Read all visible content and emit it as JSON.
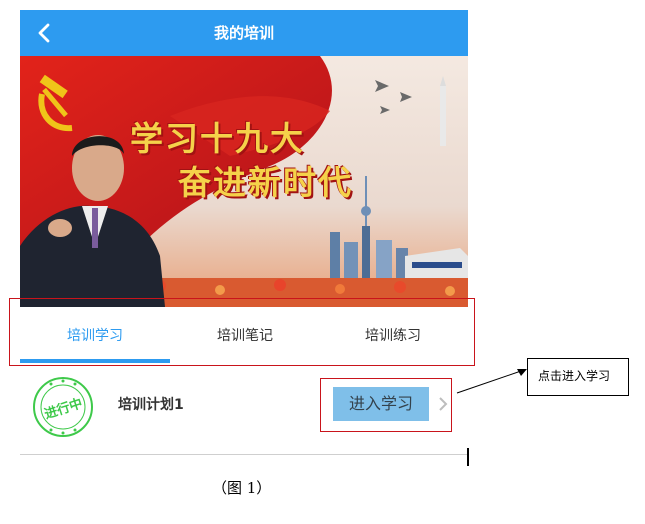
{
  "header": {
    "title": "我的培训",
    "back_icon": "chevron-left-icon"
  },
  "banner": {
    "line1": "学习十九大",
    "line2": "奋进新时代"
  },
  "tabs": [
    {
      "label": "培训学习",
      "active": true
    },
    {
      "label": "培训笔记",
      "active": false
    },
    {
      "label": "培训练习",
      "active": false
    }
  ],
  "training_item": {
    "stamp_text": "进行中",
    "name": "培训计划1",
    "button_label": "进入学习"
  },
  "annotation": {
    "note": "点击进入学习"
  },
  "caption": "（图 1）",
  "colors": {
    "primary": "#2d9bf0",
    "button_bg": "#7fbfe9",
    "highlight_border": "#c9141b",
    "stamp": "#3ec94a"
  }
}
